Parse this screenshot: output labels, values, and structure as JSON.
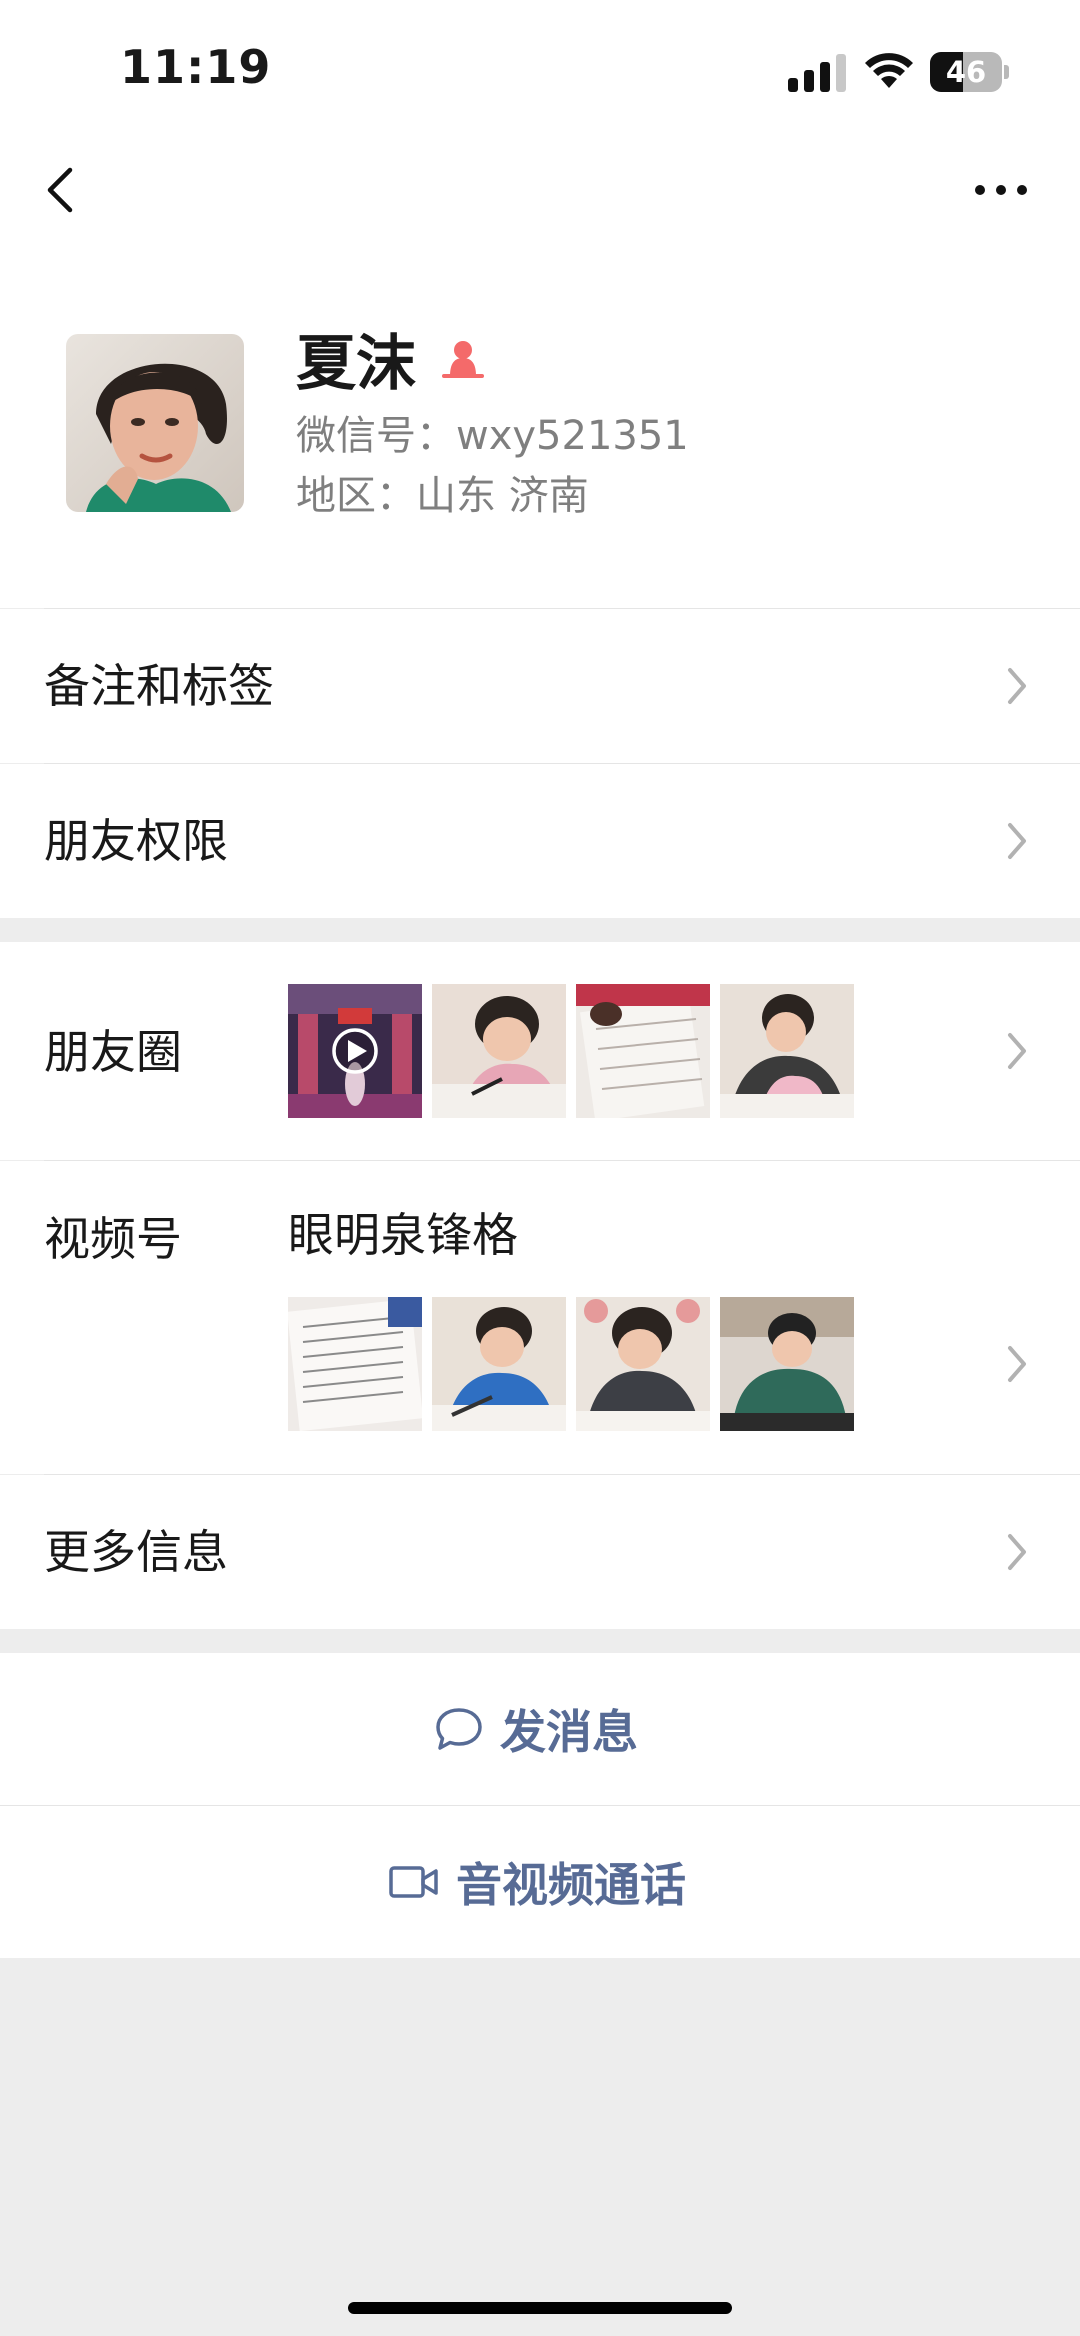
{
  "status_bar": {
    "time": "11:19",
    "battery_level": "46",
    "battery_fraction": 0.46,
    "signal_icon": "cellular-signal-icon",
    "wifi_icon": "wifi-icon"
  },
  "navbar": {
    "back_icon": "chevron-left-icon",
    "more_icon": "more-dots-icon"
  },
  "profile": {
    "name": "夏沫",
    "gender_icon": "female-icon",
    "gender_color": "#f46a6a",
    "wechat_id": "微信号：wxy521351",
    "region": "地区：山东 济南"
  },
  "menu": {
    "remarks_tags": "备注和标签",
    "friend_permissions": "朋友权限",
    "moments": "朋友圈",
    "channels": "视频号",
    "channel_name": "眼明泉锋格",
    "more_info": "更多信息"
  },
  "actions": {
    "send_message": "发消息",
    "av_call": "音视频通话",
    "accent_color": "#576b95"
  }
}
